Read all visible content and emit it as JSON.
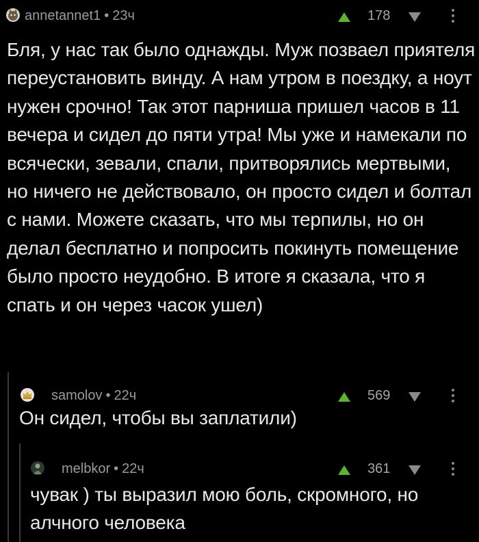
{
  "comments": [
    {
      "username": "annetannet1",
      "time": "23ч",
      "rating": "178",
      "avatar_icon": "cat-face-avatar",
      "text": "Бля, у нас так было однажды. Муж позваел приятеля переустановить винду. А нам утром в поездку, а ноут нужен срочно! Так этот парниша пришел часов в 11 вечера и сидел до пяти утра! Мы уже и намекали по всячески, зевали, спали, притворялись мертвыми, но ничего не действовало, он просто сидел и болтал с нами. Можете сказать, что мы терпилы, но он делал бесплатно и попросить покинуть помещение было просто неудобно. В итоге я сказала, что я спать и он через часок ушел)"
    },
    {
      "username": "samolov",
      "time": "22ч",
      "rating": "569",
      "avatar_icon": "crown-avatar",
      "text": "Он сидел, чтобы вы заплатили)"
    },
    {
      "username": "melbkor",
      "time": "22ч",
      "rating": "361",
      "avatar_icon": "figure-avatar",
      "text": "чувак ) ты выразил мою боль, скромного, но алчного человека"
    }
  ],
  "separator": "•",
  "colors": {
    "background": "#000000",
    "upvote": "#5ab531",
    "downvote": "#8a8a8a",
    "meta_text": "#9b9b9b",
    "body_text": "#e8e8e8",
    "thread_line": "#3b3b3b"
  }
}
